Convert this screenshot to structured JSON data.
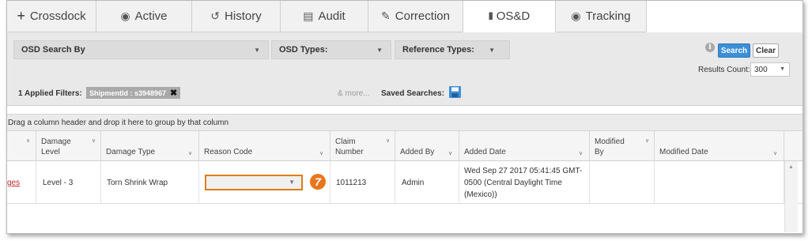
{
  "tabs": [
    {
      "label": "Crossdock",
      "icon": "plus-icon",
      "glyph": "+"
    },
    {
      "label": "Active",
      "icon": "active-icon",
      "glyph": "◉"
    },
    {
      "label": "History",
      "icon": "history-icon",
      "glyph": "↺"
    },
    {
      "label": "Audit",
      "icon": "audit-icon",
      "glyph": "▤"
    },
    {
      "label": "Correction",
      "icon": "pencil-icon",
      "glyph": "✎"
    },
    {
      "label": "OS&D",
      "icon": "barcode-icon",
      "glyph": "|||||"
    },
    {
      "label": "Tracking",
      "icon": "tracking-icon",
      "glyph": "◉"
    }
  ],
  "active_tab": "OS&D",
  "filters": {
    "osd_search_by": "OSD Search By",
    "osd_types": "OSD Types:",
    "reference_types": "Reference Types:",
    "search_label": "Search",
    "clear_label": "Clear",
    "results_count_label": "Results Count:",
    "results_count_value": "300",
    "applied_filters_label": "1 Applied Filters:",
    "applied_filter_chip": "ShipmentId : s3948967",
    "more_label": "& more...",
    "saved_searches_label": "Saved Searches:"
  },
  "grid": {
    "group_hint": "Drag a column header and drop it here to group by that column",
    "columns": [
      {
        "label": ""
      },
      {
        "label": "Damage Level"
      },
      {
        "label": "Damage Type"
      },
      {
        "label": "Reason Code"
      },
      {
        "label": "Claim Number"
      },
      {
        "label": "Added By"
      },
      {
        "label": "Added Date"
      },
      {
        "label": "Modified By"
      },
      {
        "label": "Modified Date"
      }
    ],
    "rows": [
      {
        "link": "ges",
        "damage_level": "Level - 3",
        "damage_type": "Torn Shrink Wrap",
        "reason_code": "",
        "claim_number": "1011213",
        "added_by": "Admin",
        "added_date": "Wed Sep 27 2017 05:41:45 GMT-0500 (Central Daylight Time (Mexico))",
        "modified_by": "",
        "modified_date": ""
      }
    ]
  },
  "callout_number": "7",
  "colors": {
    "accent_blue": "#3a8fd8",
    "callout_orange": "#e8761e",
    "link_red": "#c0262c"
  }
}
